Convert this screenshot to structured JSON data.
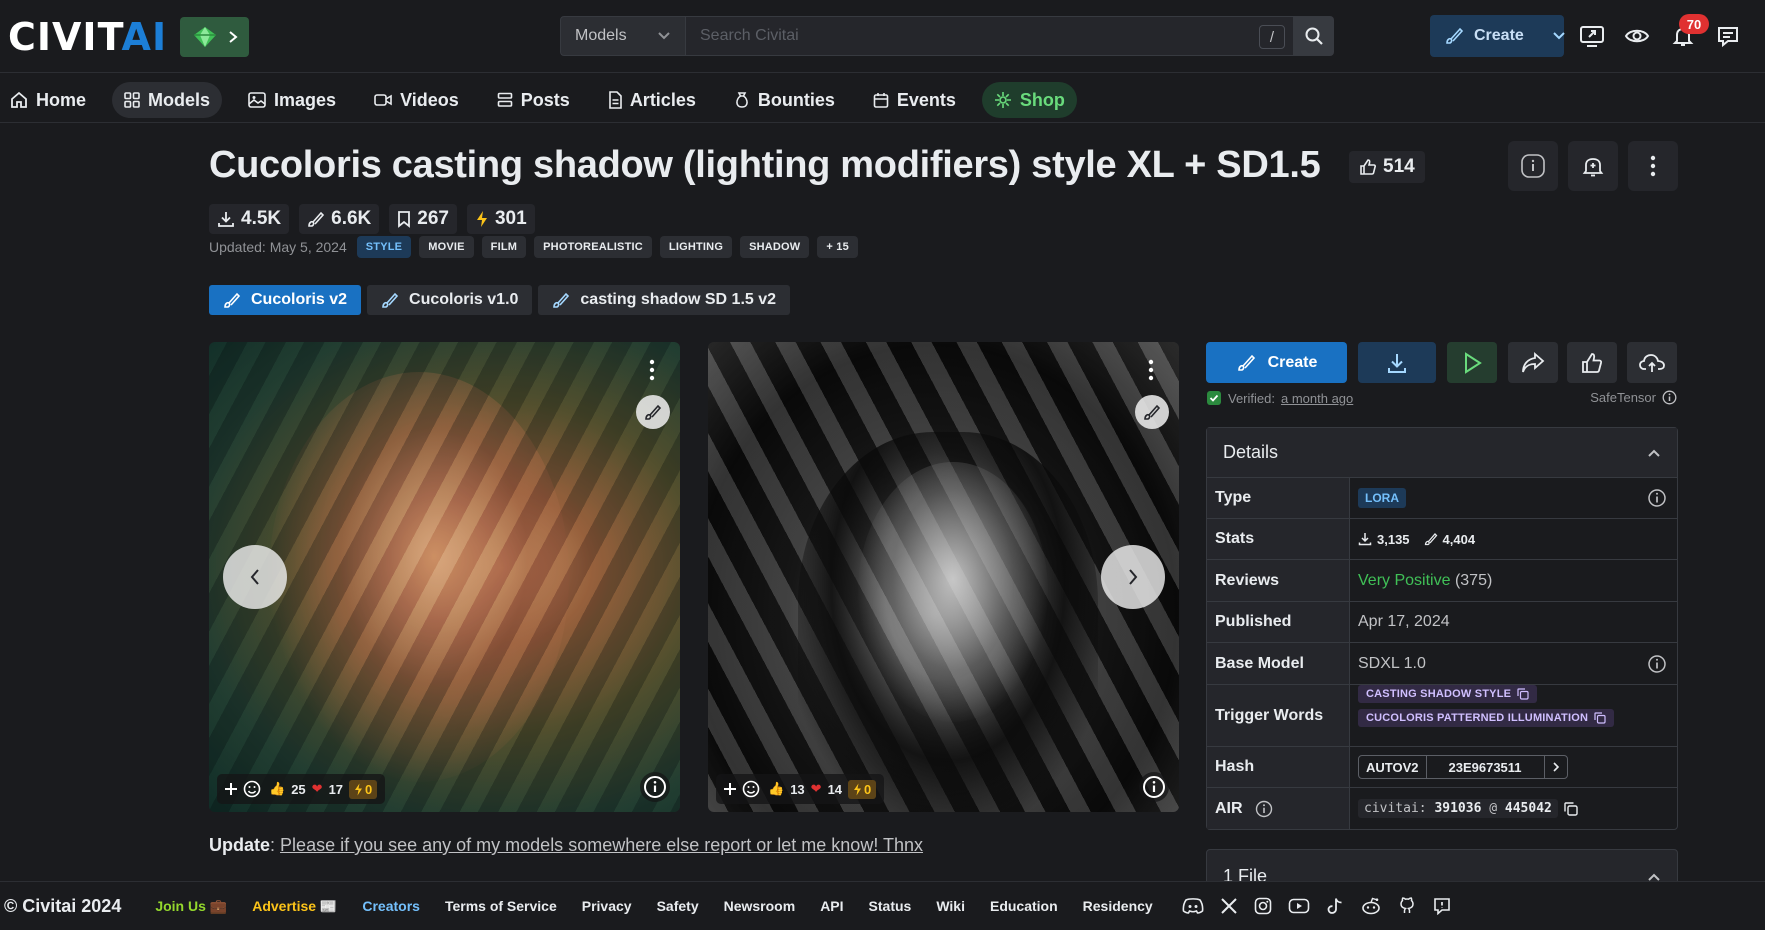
{
  "header": {
    "logo_white": "CIVIT",
    "logo_blue": "AI",
    "search_category": "Models",
    "search_placeholder": "Search Civitai",
    "search_shortcut": "/",
    "create_label": "Create",
    "notification_count": "70"
  },
  "nav": [
    {
      "label": "Home",
      "icon": "home-icon"
    },
    {
      "label": "Models",
      "icon": "grid-icon"
    },
    {
      "label": "Images",
      "icon": "photo-icon"
    },
    {
      "label": "Videos",
      "icon": "video-icon"
    },
    {
      "label": "Posts",
      "icon": "posts-icon"
    },
    {
      "label": "Articles",
      "icon": "article-icon"
    },
    {
      "label": "Bounties",
      "icon": "moneybag-icon"
    },
    {
      "label": "Events",
      "icon": "calendar-icon"
    },
    {
      "label": "Shop",
      "icon": "shop-icon"
    }
  ],
  "model": {
    "title": "Cucoloris casting shadow (lighting modifiers) style XL + SD1.5",
    "likes": "514",
    "downloads": "4.5K",
    "generations": "6.6K",
    "bookmarks": "267",
    "buzz": "301",
    "updated": "Updated: May 5, 2024",
    "tags": [
      "STYLE",
      "MOVIE",
      "FILM",
      "PHOTOREALISTIC",
      "LIGHTING",
      "SHADOW",
      "+ 15"
    ],
    "versions": [
      "Cucoloris v2",
      "Cucoloris v1.0",
      "casting shadow SD 1.5 v2"
    ]
  },
  "images": [
    {
      "thumbs": "25",
      "hearts": "17",
      "buzz": "0"
    },
    {
      "thumbs": "13",
      "hearts": "14",
      "buzz": "0"
    }
  ],
  "update": {
    "label": "Update",
    "sep": ":",
    "text": "Please if you see any of my models somewhere else report or let me know! Thnx"
  },
  "panel": {
    "create_label": "Create",
    "verified_prefix": "Verified:",
    "verified_time": "a month ago",
    "format": "SafeTensor",
    "details_title": "Details",
    "rows": {
      "type_k": "Type",
      "type_v": "LORA",
      "stats_k": "Stats",
      "stats_dl": "3,135",
      "stats_gen": "4,404",
      "reviews_k": "Reviews",
      "reviews_v": "Very Positive",
      "reviews_count": "(375)",
      "published_k": "Published",
      "published_v": "Apr 17, 2024",
      "base_k": "Base Model",
      "base_v": "SDXL 1.0",
      "trigger_k": "Trigger Words",
      "trigger_1": "CASTING SHADOW STYLE",
      "trigger_2": "CUCOLORIS PATTERNED ILLUMINATION",
      "hash_k": "Hash",
      "hash_type": "AUTOV2",
      "hash_v": "23E9673511",
      "air_k": "AIR",
      "air_prefix": "civitai:",
      "air_model": "391036",
      "air_at": "@",
      "air_version": "445042"
    },
    "files_title": "1 File"
  },
  "footer": {
    "copyright": "© Civitai 2024",
    "links": [
      "Join Us 💼",
      "Advertise 📰",
      "Creators",
      "Terms of Service",
      "Privacy",
      "Safety",
      "Newsroom",
      "API",
      "Status",
      "Wiki",
      "Education",
      "Residency"
    ]
  },
  "colors": {
    "background": "#1a1b1e",
    "accent_blue": "#1971c2",
    "shop_green": "#69db7c",
    "positive_green": "#40c057"
  }
}
